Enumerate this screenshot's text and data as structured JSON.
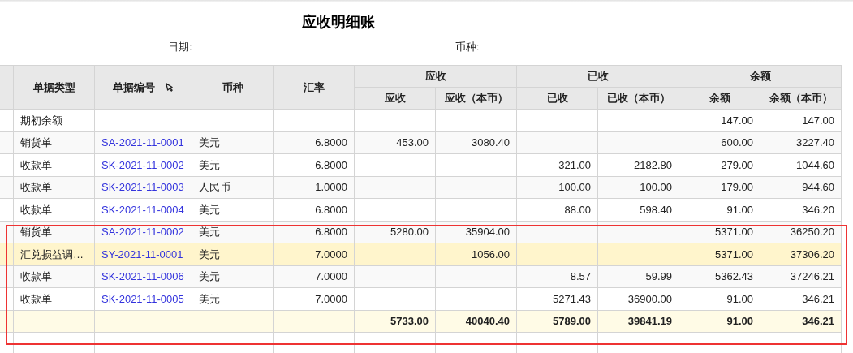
{
  "title": "应收明细账",
  "filters": [
    {
      "label": "日期:"
    },
    {
      "label": "币种:"
    }
  ],
  "table": {
    "columns": [
      {
        "label": "单据类型",
        "pinned": false
      },
      {
        "label": "单据编号",
        "pinned": true
      },
      {
        "label": "币种",
        "pinned": false
      },
      {
        "label": "汇率",
        "pinned": false
      }
    ],
    "groups": [
      {
        "label": "应收",
        "columns": [
          "应收",
          "应收（本币）"
        ]
      },
      {
        "label": "已收",
        "columns": [
          "已收",
          "已收（本币）"
        ]
      },
      {
        "label": "余额",
        "columns": [
          "余额",
          "余额（本币）"
        ]
      }
    ],
    "rows": [
      {
        "kind": "normal",
        "highlighted": false,
        "boxed": false,
        "type": "期初余额",
        "balance": "147.00",
        "balance_local": "147.00"
      },
      {
        "kind": "normal",
        "highlighted": false,
        "boxed": false,
        "type": "销货单",
        "number": "SA-2021-11-0001",
        "currency": "美元",
        "rate": "6.8000",
        "receivable": "453.00",
        "receivable_local": "3080.40",
        "balance": "600.00",
        "balance_local": "3227.40"
      },
      {
        "kind": "normal",
        "highlighted": false,
        "boxed": false,
        "type": "收款单",
        "number": "SK-2021-11-0002",
        "currency": "美元",
        "rate": "6.8000",
        "received": "321.00",
        "received_local": "2182.80",
        "balance": "279.00",
        "balance_local": "1044.60"
      },
      {
        "kind": "normal",
        "highlighted": false,
        "boxed": false,
        "type": "收款单",
        "number": "SK-2021-11-0003",
        "currency": "人民币",
        "rate": "1.0000",
        "received": "100.00",
        "received_local": "100.00",
        "balance": "179.00",
        "balance_local": "944.60"
      },
      {
        "kind": "normal",
        "highlighted": false,
        "boxed": false,
        "type": "收款单",
        "number": "SK-2021-11-0004",
        "currency": "美元",
        "rate": "6.8000",
        "received": "88.00",
        "received_local": "598.40",
        "balance": "91.00",
        "balance_local": "346.20"
      },
      {
        "kind": "normal",
        "highlighted": false,
        "boxed": true,
        "type": "销货单",
        "number": "SA-2021-11-0002",
        "currency": "美元",
        "rate": "6.8000",
        "receivable": "5280.00",
        "receivable_local": "35904.00",
        "balance": "5371.00",
        "balance_local": "36250.20"
      },
      {
        "kind": "normal",
        "highlighted": true,
        "boxed": true,
        "type": "汇兑损益调…",
        "number": "SY-2021-11-0001",
        "currency": "美元",
        "rate": "7.0000",
        "receivable_local": "1056.00",
        "balance": "5371.00",
        "balance_local": "37306.20"
      },
      {
        "kind": "normal",
        "highlighted": false,
        "boxed": true,
        "type": "收款单",
        "number": "SK-2021-11-0006",
        "currency": "美元",
        "rate": "7.0000",
        "received": "8.57",
        "received_local": "59.99",
        "balance": "5362.43",
        "balance_local": "37246.21"
      },
      {
        "kind": "normal",
        "highlighted": false,
        "boxed": true,
        "type": "收款单",
        "number": "SK-2021-11-0005",
        "currency": "美元",
        "rate": "7.0000",
        "received": "5271.43",
        "received_local": "36900.00",
        "balance": "91.00",
        "balance_local": "346.21"
      },
      {
        "kind": "total",
        "highlighted": false,
        "boxed": true,
        "receivable": "5733.00",
        "receivable_local": "40040.40",
        "received": "5789.00",
        "received_local": "39841.19",
        "balance": "91.00",
        "balance_local": "346.21"
      }
    ]
  }
}
